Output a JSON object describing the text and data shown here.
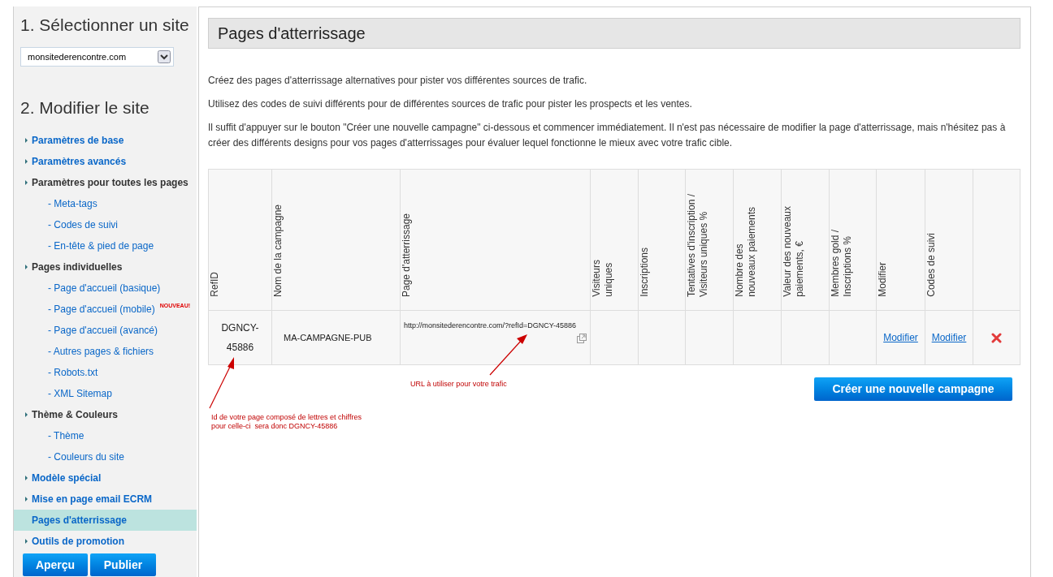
{
  "sidebar": {
    "step1_title": "1. Sélectionner un site",
    "site_select": {
      "value": "monsitederencontre.com"
    },
    "step2_title": "2. Modifier le site",
    "items": [
      {
        "kind": "link",
        "label": "Paramètres de base",
        "selected": false
      },
      {
        "kind": "group",
        "label": "Paramètres avancés",
        "selected": false,
        "link": true
      },
      {
        "kind": "group",
        "label": "Paramètres pour toutes les pages",
        "selected": false,
        "link": false
      },
      {
        "kind": "sub",
        "label": "- Meta-tags",
        "selected": false
      },
      {
        "kind": "sub",
        "label": "- Codes de suivi",
        "selected": false
      },
      {
        "kind": "sub",
        "label": "- En-tête & pied de page",
        "selected": false
      },
      {
        "kind": "group",
        "label": "Pages individuelles",
        "selected": false,
        "link": false
      },
      {
        "kind": "sub",
        "label": "- Page d'accueil (basique)",
        "selected": false
      },
      {
        "kind": "sub",
        "label": "- Page d'accueil (mobile)",
        "selected": false,
        "badge": "NOUVEAU!"
      },
      {
        "kind": "sub",
        "label": "- Page d'accueil (avancé)",
        "selected": false
      },
      {
        "kind": "sub",
        "label": "- Autres pages & fichiers",
        "selected": false
      },
      {
        "kind": "sub",
        "label": "- Robots.txt",
        "selected": false
      },
      {
        "kind": "sub",
        "label": "- XML Sitemap",
        "selected": false
      },
      {
        "kind": "group",
        "label": "Thème & Couleurs",
        "selected": false,
        "link": false
      },
      {
        "kind": "sub",
        "label": "- Thème",
        "selected": false
      },
      {
        "kind": "sub",
        "label": "- Couleurs du site",
        "selected": false
      },
      {
        "kind": "group",
        "label": "Modèle spécial",
        "selected": false,
        "link": true
      },
      {
        "kind": "group",
        "label": "Mise en page email ECRM",
        "selected": false,
        "link": true
      },
      {
        "kind": "group",
        "label": "Pages d'atterrissage",
        "selected": true,
        "link": true
      },
      {
        "kind": "group",
        "label": "Outils de promotion",
        "selected": false,
        "link": true
      }
    ],
    "buttons": [
      "Aperçu",
      "Publier"
    ]
  },
  "main": {
    "title": "Pages d'atterrissage",
    "paragraphs": [
      "Créez des pages d'atterrissage alternatives pour pister vos différentes sources de trafic.",
      "Utilisez des codes de suivi différents pour de différentes sources de trafic pour pister les prospects et les ventes.",
      "Il suffit d'appuyer sur le bouton \"Créer une nouvelle campagne\" ci-dessous et commencer immédiatement. Il n'est pas nécessaire de modifier la page d'atterrissage, mais n'hésitez pas à créer des différents designs pour vos pages d'atterrissages pour évaluer lequel fonctionne le mieux avec votre trafic cible."
    ],
    "table": {
      "columns": [
        "RefID",
        "Nom de la campagne",
        "Page d'atterrissage",
        "Visiteurs\nuniques",
        "Inscriptions",
        "Tentatives d'inscription /\nVisiteurs uniques %",
        "Nombre des\nnouveaux paiements",
        "Valeur des nouveaux\npaiements, €",
        "Membres gold /\nInscriptions %",
        "Modifier",
        "Codes de suivi"
      ],
      "rows": [
        {
          "refid": "DGNCY-\n\n45886",
          "campaign": "MA-CAMPAGNE-PUB",
          "url": "http://monsitederencontre.com/?refId=DGNCY-45886",
          "edit": "Modifier",
          "tracking": "Modifier"
        }
      ]
    },
    "create_button": "Créer une nouvelle campagne",
    "annotations": [
      "URL à utiliser pour votre trafic",
      "Id de votre page composé de lettres et chiffres\npour celle-ci  sera donc DGNCY-45886"
    ]
  }
}
